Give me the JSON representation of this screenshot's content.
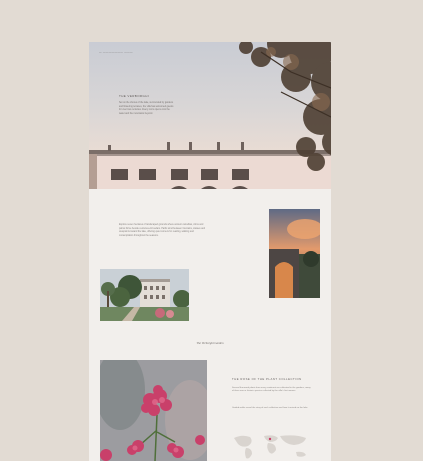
{
  "nav": {
    "breadcrumb": "— ——————— ———"
  },
  "hero": {
    "heading": "THE VERBORGHI",
    "body": "Set on the shores of the lake, surrounded by gardens and flowering terraces, the villa has welcomed guests for over two centuries. Every room opens onto the water and the mountains beyond."
  },
  "intro": {
    "body": "Explore seven hectares of landscaped grounds where ancient camellias, citrus and palms thrive beside centuries-old cedars. Paths wind between fountains, statues and viewpoints toward the lake, offering quiet corners for reading, walking and contemplation throughout the seasons."
  },
  "gallery": {
    "caption": "The Verborghi Garden"
  },
  "collection": {
    "title": "THE ROSE OF THE PLANT COLLECTION",
    "body1": "Several thousand plants from every continent are cultivated in the gardens, many of them rare or historic species collected by the villa's first owners.",
    "body2": "Guided walks reveal the story of each collection and how it arrived on the lake."
  },
  "colors": {
    "page_bg": "#f2efec",
    "outer_bg": "#e2dbd3",
    "building": "#eddcd6",
    "foliage": "#5a4a3a"
  }
}
